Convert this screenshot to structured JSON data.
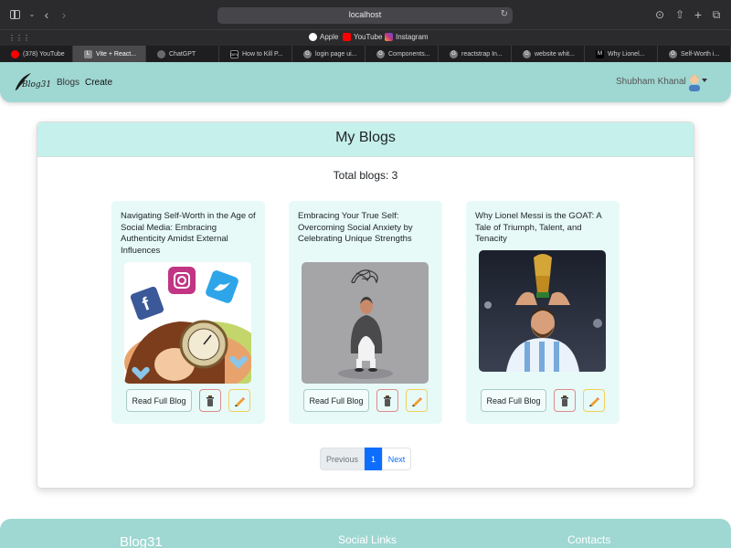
{
  "browser": {
    "url": "localhost",
    "favorites": [
      {
        "label": "Apple",
        "icon": "apple-icon",
        "color": "#ffffff"
      },
      {
        "label": "YouTube",
        "icon": "youtube-icon",
        "color": "#ff0000"
      },
      {
        "label": "Instagram",
        "icon": "instagram-icon",
        "color": "#c13584"
      }
    ],
    "tabs": [
      {
        "label": "(378) YouTube",
        "icon": "youtube-icon",
        "color": "#ff0000",
        "text": "",
        "active": false
      },
      {
        "label": "Vite + React...",
        "icon": "vite-icon",
        "color": "#8a8a8a",
        "text": "L",
        "active": true
      },
      {
        "label": "ChatGPT",
        "icon": "chatgpt-icon",
        "color": "#6a6a6a",
        "text": "",
        "active": false
      },
      {
        "label": "How to Kill P...",
        "icon": "dev-icon",
        "color": "#000000",
        "text": "DEV",
        "active": false
      },
      {
        "label": "login page ui...",
        "icon": "google-icon",
        "color": "#7a7a7a",
        "text": "G",
        "active": false
      },
      {
        "label": "Components...",
        "icon": "google-icon",
        "color": "#7a7a7a",
        "text": "G",
        "active": false
      },
      {
        "label": "reactstrap In...",
        "icon": "google-icon",
        "color": "#7a7a7a",
        "text": "G",
        "active": false
      },
      {
        "label": "website whit...",
        "icon": "google-icon",
        "color": "#7a7a7a",
        "text": "G",
        "active": false
      },
      {
        "label": "Why Lionel...",
        "icon": "medium-icon",
        "color": "#000000",
        "text": "M",
        "active": false
      },
      {
        "label": "Self-Worth i...",
        "icon": "google-icon",
        "color": "#7a7a7a",
        "text": "G",
        "active": false
      }
    ]
  },
  "navbar": {
    "brand": "Blog31",
    "links": {
      "blogs": "Blogs",
      "create": "Create"
    },
    "username": "Shubham Khanal",
    "color": "#9fd7d2"
  },
  "main": {
    "title": "My Blogs",
    "total": "Total blogs: 3",
    "read_label": "Read Full Blog",
    "blogs": [
      {
        "title": "Navigating Self-Worth in the Age of Social Media: Embracing Authenticity Amidst External Influences",
        "image": "social-media-illustration"
      },
      {
        "title": "Embracing Your True Self: Overcoming Social Anxiety by Celebrating Unique Strengths",
        "image": "anxious-person-illustration"
      },
      {
        "title": "Why Lionel Messi is the GOAT: A Tale of Triumph, Talent, and Tenacity",
        "image": "messi-trophy-photo"
      }
    ]
  },
  "pagination": {
    "previous": "Previous",
    "current": "1",
    "next": "Next"
  },
  "footer": {
    "brand": "Blog31",
    "social": "Social Links",
    "contacts": "Contacts"
  }
}
